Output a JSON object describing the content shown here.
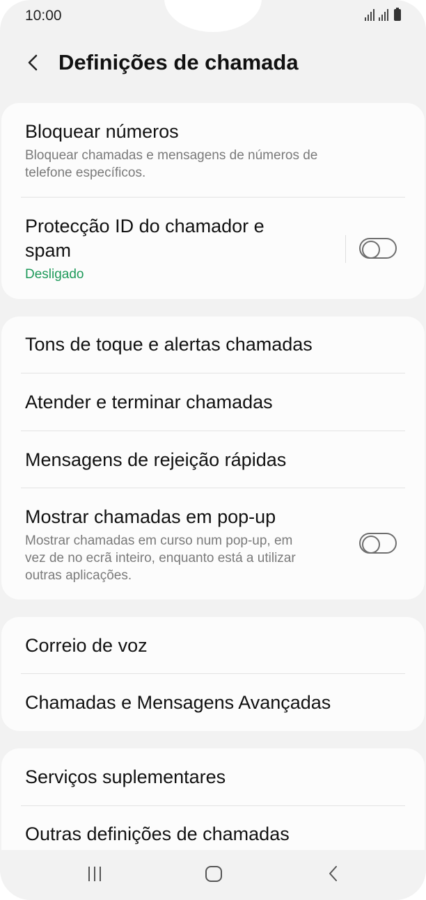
{
  "status_bar": {
    "time": "10:00"
  },
  "header": {
    "title": "Definições de chamada"
  },
  "sections": [
    {
      "items": [
        {
          "title": "Bloquear números",
          "subtitle_lines": [
            "Bloquear chamadas e mensagens de números de",
            "telefone específicos."
          ]
        },
        {
          "title_lines": [
            "Protecção ID do chamador e",
            "spam"
          ],
          "status": "Desligado",
          "toggle": "off"
        }
      ]
    },
    {
      "items": [
        {
          "title": "Tons de toque e alertas chamadas"
        },
        {
          "title": "Atender e terminar chamadas"
        },
        {
          "title": "Mensagens de rejeição rápidas"
        },
        {
          "title": "Mostrar chamadas em pop-up",
          "subtitle_lines": [
            "Mostrar chamadas em curso num pop-up, em",
            "vez de no ecrã inteiro, enquanto está a utilizar",
            "outras aplicações."
          ],
          "toggle": "off"
        }
      ]
    },
    {
      "items": [
        {
          "title": "Correio de voz"
        },
        {
          "title": "Chamadas e Mensagens Avançadas"
        }
      ]
    },
    {
      "items": [
        {
          "title": "Serviços suplementares"
        },
        {
          "title": "Outras definições de chamadas"
        }
      ]
    }
  ],
  "navbar": {
    "recents": "recents-icon",
    "home": "home-icon",
    "back": "back-icon"
  },
  "colors": {
    "status_green": "#1e9a5a",
    "background": "#f2f2f2",
    "card": "#fcfcfc"
  }
}
